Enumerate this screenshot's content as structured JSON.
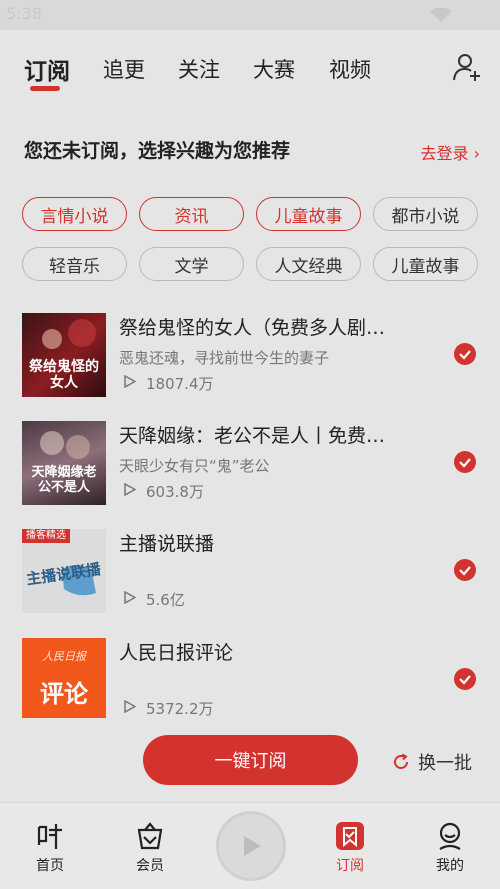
{
  "status": {
    "time": "5:38"
  },
  "tabs": [
    {
      "label": "订阅",
      "active": true
    },
    {
      "label": "追更",
      "active": false
    },
    {
      "label": "关注",
      "active": false
    },
    {
      "label": "大赛",
      "active": false
    },
    {
      "label": "视频",
      "active": false
    }
  ],
  "recommend": {
    "header": "您还未订阅，选择兴趣为您推荐",
    "login": "去登录 ›"
  },
  "tags": [
    {
      "label": "言情小说",
      "selected": true
    },
    {
      "label": "资讯",
      "selected": true
    },
    {
      "label": "儿童故事",
      "selected": true
    },
    {
      "label": "都市小说",
      "selected": false
    },
    {
      "label": "轻音乐",
      "selected": false
    },
    {
      "label": "文学",
      "selected": false
    },
    {
      "label": "人文经典",
      "selected": false
    },
    {
      "label": "儿童故事",
      "selected": false
    }
  ],
  "items": [
    {
      "title": "祭给鬼怪的女人（免费多人剧…",
      "subtitle": "恶鬼还魂，寻找前世今生的妻子",
      "plays": "1807.4万",
      "cover_text": "祭给鬼怪的女人",
      "checked": true
    },
    {
      "title": "天降姻缘：老公不是人丨免费…",
      "subtitle": "天眼少女有只“鬼”老公",
      "plays": "603.8万",
      "cover_text": "天降姻缘老公不是人",
      "checked": true
    },
    {
      "title": "主播说联播",
      "subtitle": "",
      "plays": "5.6亿",
      "cover_badge": "播客精选",
      "cover_text": "主播说联播",
      "checked": true
    },
    {
      "title": "人民日报评论",
      "subtitle": "",
      "plays": "5372.2万",
      "cover_top": "人民日报",
      "cover_text": "评论",
      "checked": true
    }
  ],
  "actions": {
    "subscribe_all": "一键订阅",
    "refresh": "换一批"
  },
  "nav": [
    {
      "label": "首页",
      "active": false
    },
    {
      "label": "会员",
      "active": false
    },
    {
      "label": "订阅",
      "active": true
    },
    {
      "label": "我的",
      "active": false
    }
  ],
  "colors": {
    "accent": "#d2332f",
    "background": "#e5e5e5"
  }
}
